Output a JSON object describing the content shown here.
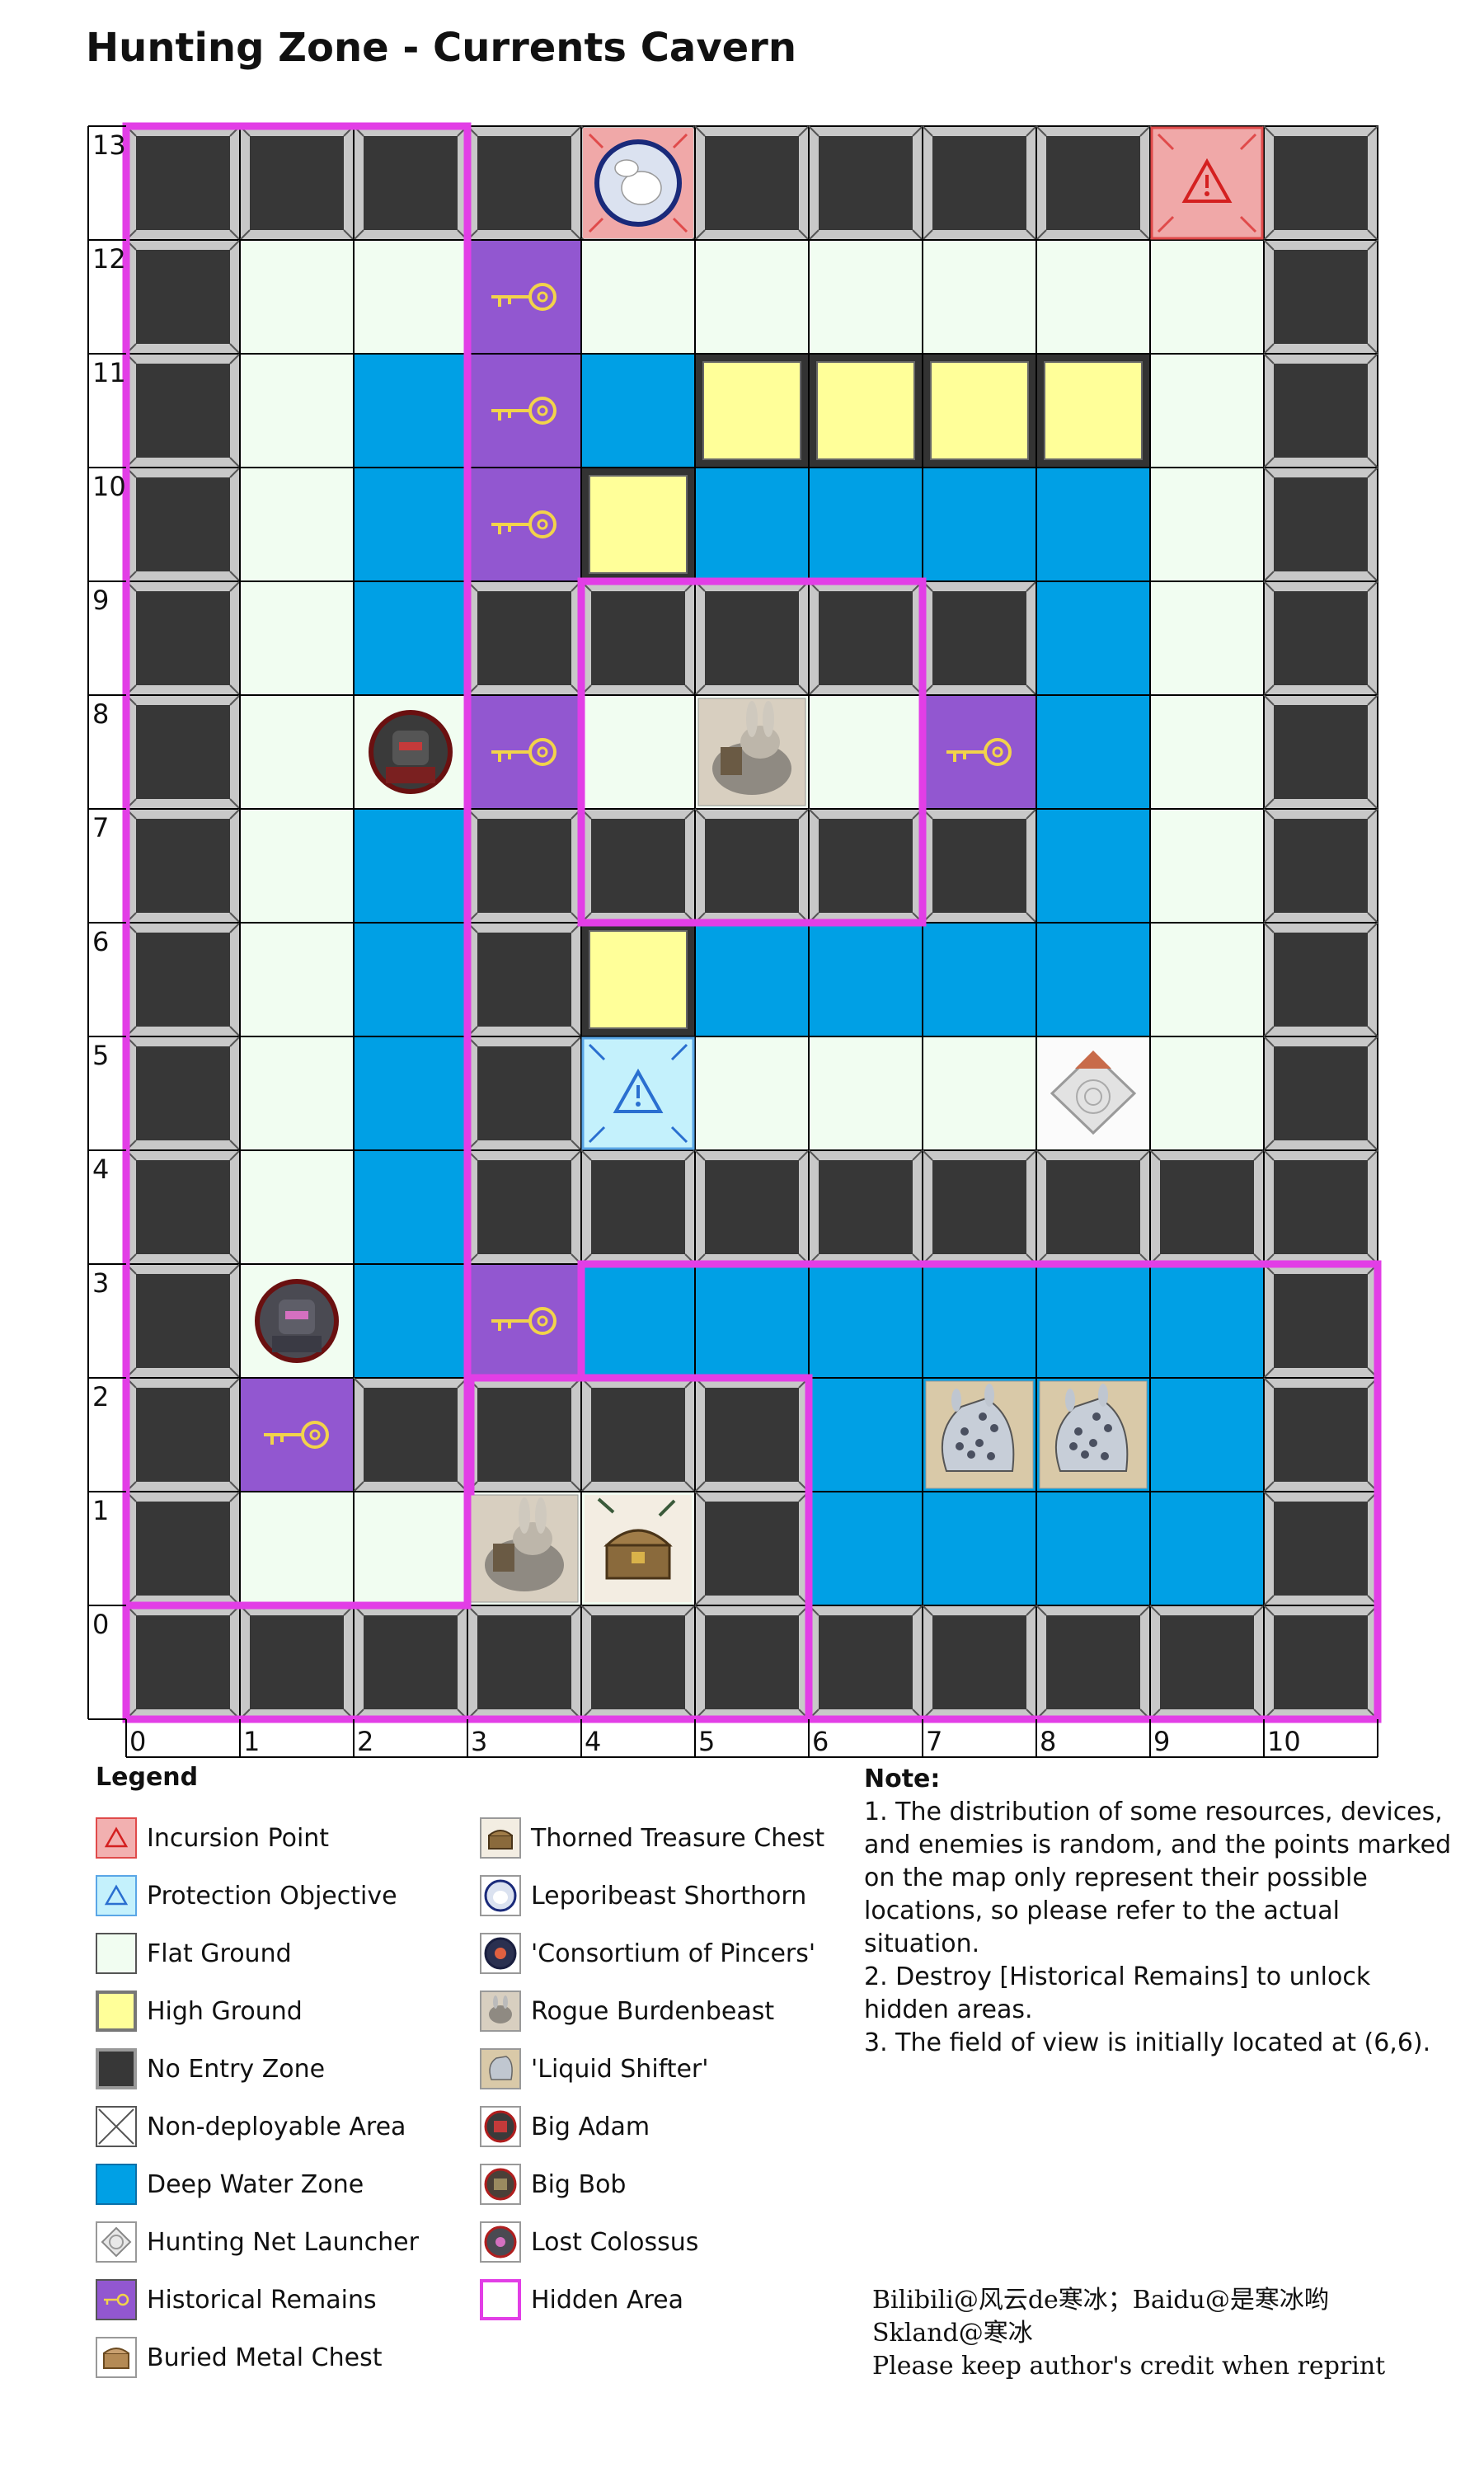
{
  "title": "Hunting Zone - Currents Cavern",
  "map": {
    "cols": 11,
    "rows": 14,
    "x_labels": [
      "0",
      "1",
      "2",
      "3",
      "4",
      "5",
      "6",
      "7",
      "8",
      "9",
      "10"
    ],
    "y_labels": [
      "0",
      "1",
      "2",
      "3",
      "4",
      "5",
      "6",
      "7",
      "8",
      "9",
      "10",
      "11",
      "12",
      "13"
    ],
    "grid_rows_top_to_bottom": [
      "NNNNNNNNNNN",
      "NFFRFFFFFFN",
      "NFDRDHHHHFN",
      "NFDRHDDDDFN",
      "NFDNNNNNDFN",
      "NFFRFFFRDFN",
      "NFDNNNNNDFN",
      "NFDNHDDDDFN",
      "NFDNPFFFFFN",
      "NFDNNNNNNNN",
      "NFDRDDDDDDN",
      "NRNNNNDDDDN",
      "NFFFFNDDDDN",
      "NNNNNNNNNNN"
    ],
    "colors": {
      "N": "#373737",
      "F": "#f1fdf1",
      "D": "#00a0e5",
      "H": "#ffff99",
      "R": "#9257d0",
      "incursion": "#f0a8a8",
      "protection": "#c4f1fc",
      "hidden_area": "#e23ee6"
    },
    "markers": [
      {
        "type": "incursion-point",
        "x": 9,
        "y": 13
      },
      {
        "type": "leporibeast-shorthorn",
        "x": 4,
        "y": 13
      },
      {
        "type": "protection-objective",
        "x": 4,
        "y": 5
      },
      {
        "type": "hunting-net-launcher",
        "x": 8,
        "y": 5
      },
      {
        "type": "rogue-burdenbeast",
        "x": 5,
        "y": 8
      },
      {
        "type": "rogue-burdenbeast",
        "x": 3,
        "y": 1
      },
      {
        "type": "thorned-treasure-chest",
        "x": 4,
        "y": 1
      },
      {
        "type": "liquid-shifter",
        "x": 7,
        "y": 2
      },
      {
        "type": "liquid-shifter",
        "x": 8,
        "y": 2
      },
      {
        "type": "big-adam",
        "x": 2,
        "y": 8
      },
      {
        "type": "lost-colossus",
        "x": 1,
        "y": 3
      }
    ]
  },
  "legend": {
    "title": "Legend",
    "items": [
      {
        "id": "incursion-point",
        "label": "Incursion Point"
      },
      {
        "id": "protection-objective",
        "label": "Protection Objective"
      },
      {
        "id": "flat-ground",
        "label": "Flat Ground"
      },
      {
        "id": "high-ground",
        "label": "High Ground"
      },
      {
        "id": "no-entry-zone",
        "label": "No Entry Zone"
      },
      {
        "id": "non-deployable-area",
        "label": "Non-deployable Area"
      },
      {
        "id": "deep-water-zone",
        "label": "Deep Water Zone"
      },
      {
        "id": "hunting-net-launcher",
        "label": "Hunting Net Launcher"
      },
      {
        "id": "historical-remains",
        "label": "Historical Remains"
      },
      {
        "id": "buried-metal-chest",
        "label": "Buried Metal Chest"
      },
      {
        "id": "thorned-treasure-chest",
        "label": "Thorned Treasure Chest"
      },
      {
        "id": "leporibeast-shorthorn",
        "label": "Leporibeast Shorthorn"
      },
      {
        "id": "consortium-of-pincers",
        "label": "'Consortium of Pincers'"
      },
      {
        "id": "rogue-burdenbeast",
        "label": "Rogue Burdenbeast"
      },
      {
        "id": "liquid-shifter",
        "label": "'Liquid Shifter'"
      },
      {
        "id": "big-adam",
        "label": "Big Adam"
      },
      {
        "id": "big-bob",
        "label": "Big Bob"
      },
      {
        "id": "lost-colossus",
        "label": "Lost Colossus"
      },
      {
        "id": "hidden-area",
        "label": "Hidden Area"
      }
    ]
  },
  "note": {
    "title": "Note:",
    "lines": [
      "1. The distribution of some resources, devices, and enemies is random, and the points marked on the map only represent their possible locations, so please refer to the actual situation.",
      "2. Destroy [Historical Remains] to unlock hidden areas.",
      "3. The field of view is initially located at (6,6)."
    ]
  },
  "credit": {
    "line1": "Bilibili@风云de寒冰；Baidu@是寒冰哟",
    "line2": "Skland@寒冰",
    "line3": "Please keep author's credit when reprint"
  }
}
